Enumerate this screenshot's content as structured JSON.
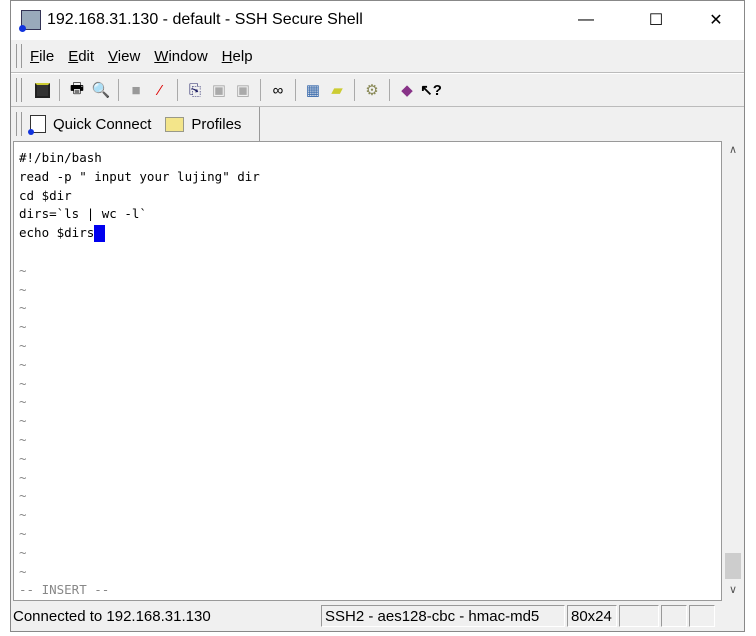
{
  "window": {
    "title": "192.168.31.130 - default - SSH Secure Shell",
    "minimize": "—",
    "maximize": "☐",
    "close": "✕"
  },
  "menu": [
    {
      "label": "File",
      "key": "F",
      "rest": "ile"
    },
    {
      "label": "Edit",
      "key": "E",
      "rest": "dit"
    },
    {
      "label": "View",
      "key": "V",
      "rest": "iew"
    },
    {
      "label": "Window",
      "key": "W",
      "rest": "indow"
    },
    {
      "label": "Help",
      "key": "H",
      "rest": "elp"
    }
  ],
  "toolbar": [
    "save-icon",
    "print-icon",
    "print-preview-icon",
    "disconnect-icon",
    "reconnect-icon",
    "copy-icon",
    "paste-icon",
    "paste-alt-icon",
    "find-icon",
    "new-terminal-icon",
    "new-file-transfer-icon",
    "settings-icon",
    "help-book-icon",
    "whats-this-icon"
  ],
  "quickbar": {
    "quick_connect": "Quick Connect",
    "profiles": "Profiles"
  },
  "terminal": {
    "lines": [
      "#!/bin/bash",
      "read -p \" input your lujing\" dir",
      "cd $dir",
      "dirs=`ls | wc -l`",
      "echo $dirs",
      ""
    ],
    "tilde": "~",
    "tilde_count": 17,
    "mode": "-- INSERT --",
    "cursor_color": "#0000ee"
  },
  "status": {
    "connection": "Connected to 192.168.31.130",
    "cipher": "SSH2 - aes128-cbc - hmac-md5",
    "size": "80x24"
  }
}
